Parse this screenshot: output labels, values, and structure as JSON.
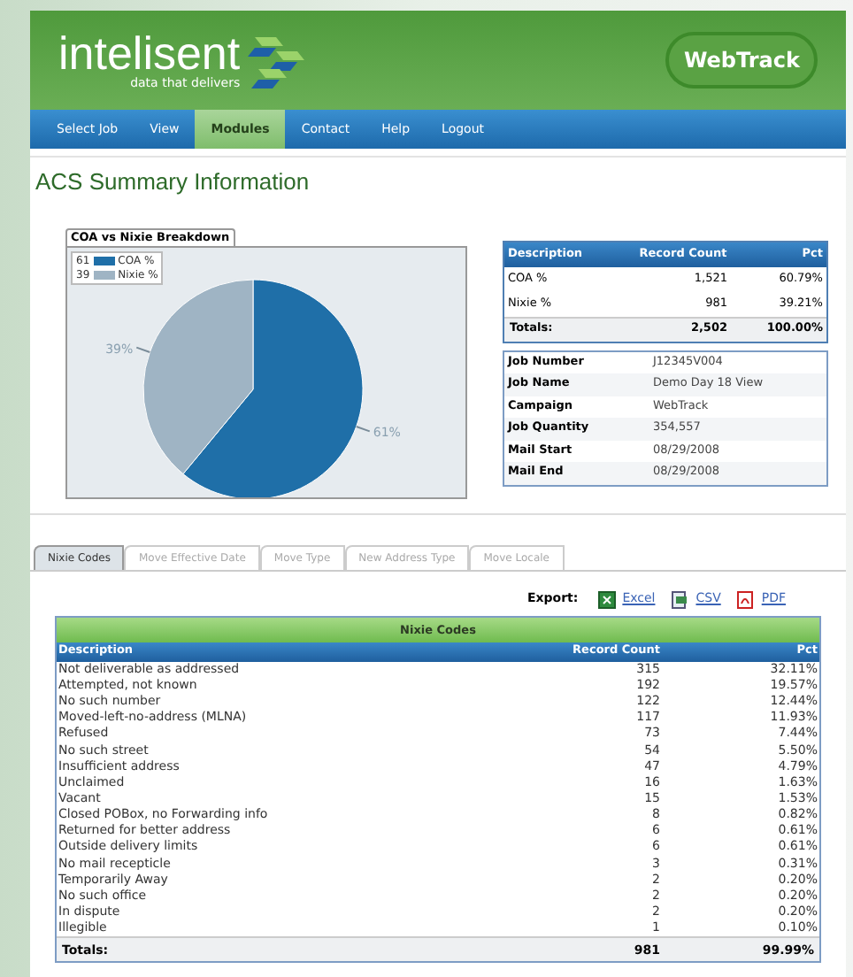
{
  "header": {
    "logo_text": "intelisent",
    "tagline": "data that delivers",
    "badge": "WebTrack"
  },
  "nav": [
    {
      "label": "Select Job",
      "selected": false
    },
    {
      "label": "View",
      "selected": false
    },
    {
      "label": "Modules",
      "selected": true
    },
    {
      "label": "Contact",
      "selected": false
    },
    {
      "label": "Help",
      "selected": false
    },
    {
      "label": "Logout",
      "selected": false
    }
  ],
  "page_title": "ACS Summary Information",
  "chart": {
    "legend_values": [
      "61",
      "39"
    ],
    "chart_data": {
      "type": "pie",
      "title": "COA vs Nixie Breakdown",
      "categories": [
        "COA %",
        "Nixie %"
      ],
      "series": [
        {
          "values": [
            61,
            39
          ],
          "colors": [
            "#1f6fa8",
            "#9fb4c4"
          ]
        }
      ],
      "value_labels": [
        "61%",
        "39%"
      ]
    }
  },
  "summary_table": {
    "columns": [
      "Description",
      "Record Count",
      "Pct"
    ],
    "rows": [
      [
        "COA %",
        "1,521",
        "60.79%"
      ],
      [
        "Nixie %",
        "981",
        "39.21%"
      ]
    ],
    "totals": [
      "Totals:",
      "2,502",
      "100.00%"
    ]
  },
  "job_info": [
    [
      "Job Number",
      "J12345V004"
    ],
    [
      "Job Name",
      "Demo Day 18 View"
    ],
    [
      "Campaign",
      "WebTrack"
    ],
    [
      "Job Quantity",
      "354,557"
    ],
    [
      "Mail Start",
      "08/29/2008"
    ],
    [
      "Mail End",
      "08/29/2008"
    ]
  ],
  "tabs": [
    {
      "label": "Nixie Codes",
      "selected": true
    },
    {
      "label": "Move Effective Date",
      "selected": false
    },
    {
      "label": "Move Type",
      "selected": false
    },
    {
      "label": "New Address Type",
      "selected": false
    },
    {
      "label": "Move Locale",
      "selected": false
    }
  ],
  "export": {
    "label": "Export:",
    "links": [
      {
        "kind": "excel",
        "label": "Excel"
      },
      {
        "kind": "csv",
        "label": "CSV"
      },
      {
        "kind": "pdf",
        "label": "PDF"
      }
    ]
  },
  "nixie_table": {
    "title": "Nixie Codes",
    "columns": [
      "Description",
      "Record Count",
      "Pct"
    ],
    "rows": [
      [
        "Not deliverable as addressed",
        "315",
        "32.11%"
      ],
      [
        "Attempted, not known",
        "192",
        "19.57%"
      ],
      [
        "No such number",
        "122",
        "12.44%"
      ],
      [
        "Moved-left-no-address (MLNA)",
        "117",
        "11.93%"
      ],
      [
        "Refused",
        "73",
        "7.44%"
      ],
      [
        "No such street",
        "54",
        "5.50%"
      ],
      [
        "Insufficient address",
        "47",
        "4.79%"
      ],
      [
        "Unclaimed",
        "16",
        "1.63%"
      ],
      [
        "Vacant",
        "15",
        "1.53%"
      ],
      [
        "Closed POBox, no Forwarding info",
        "8",
        "0.82%"
      ],
      [
        "Returned for better address",
        "6",
        "0.61%"
      ],
      [
        "Outside delivery limits",
        "6",
        "0.61%"
      ],
      [
        "No mail recepticle",
        "3",
        "0.31%"
      ],
      [
        "Temporarily Away",
        "2",
        "0.20%"
      ],
      [
        "No such office",
        "2",
        "0.20%"
      ],
      [
        "In dispute",
        "2",
        "0.20%"
      ],
      [
        "Illegible",
        "1",
        "0.10%"
      ]
    ],
    "totals": [
      "Totals:",
      "981",
      "99.99%"
    ]
  }
}
